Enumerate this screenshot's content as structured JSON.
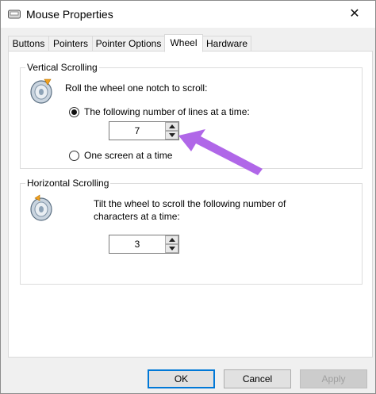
{
  "window": {
    "title": "Mouse Properties",
    "close_label": "✕",
    "title_icon": "mouse-icon"
  },
  "tabs": [
    {
      "label": "Buttons",
      "active": false
    },
    {
      "label": "Pointers",
      "active": false
    },
    {
      "label": "Pointer Options",
      "active": false
    },
    {
      "label": "Wheel",
      "active": true
    },
    {
      "label": "Hardware",
      "active": false
    }
  ],
  "vertical": {
    "group_title": "Vertical Scrolling",
    "instruction": "Roll the wheel one notch to scroll:",
    "option_lines_label": "The following number of lines at a time:",
    "option_lines_selected": true,
    "lines_value": "7",
    "option_screen_label": "One screen at a time",
    "option_screen_selected": false,
    "icon": "mouse-wheel-icon"
  },
  "horizontal": {
    "group_title": "Horizontal Scrolling",
    "instruction_line1": "Tilt the wheel to scroll the following number of",
    "instruction_line2": "characters at a time:",
    "chars_value": "3",
    "icon": "mouse-tilt-icon"
  },
  "buttons": {
    "ok": "OK",
    "cancel": "Cancel",
    "apply": "Apply"
  },
  "annotation": {
    "arrow_color": "#b067e8"
  }
}
